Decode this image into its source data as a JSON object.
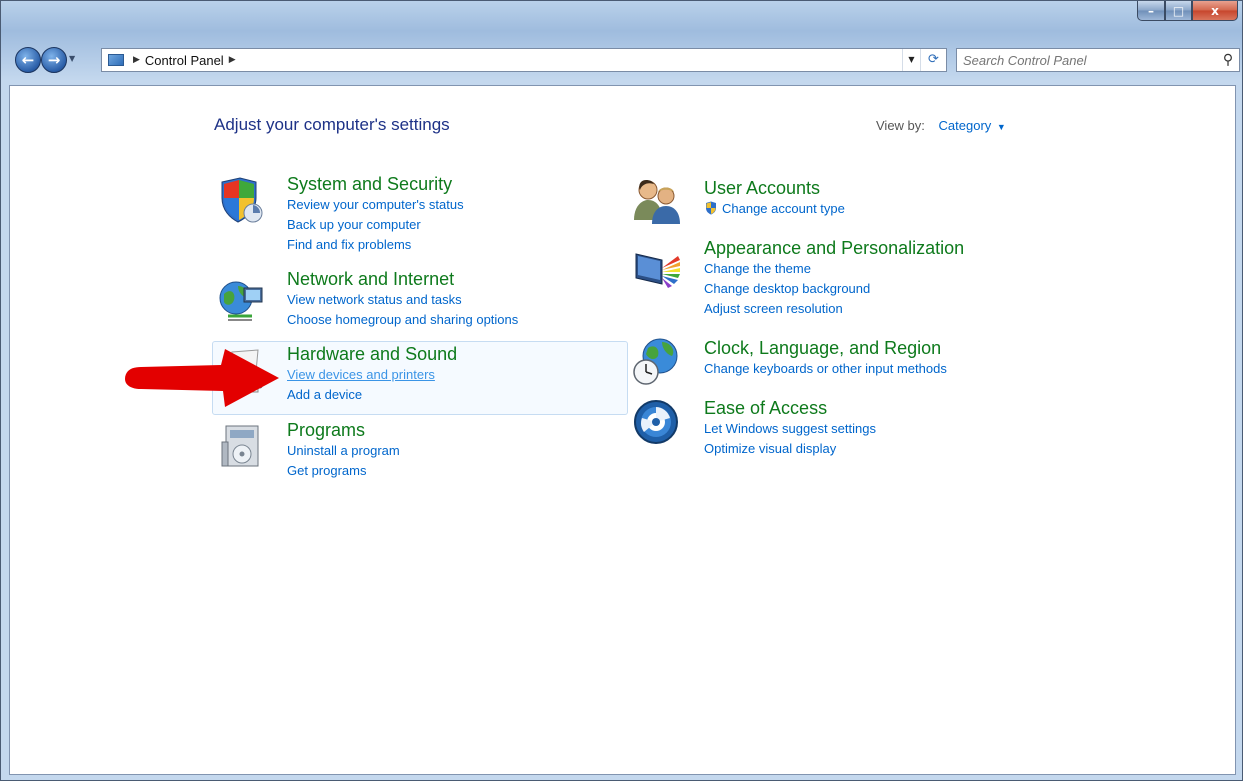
{
  "window": {
    "minimize_label": "–",
    "maximize_label": "□",
    "close_label": "x"
  },
  "nav": {
    "back_icon": "back-arrow-icon",
    "forward_icon": "forward-arrow-icon"
  },
  "address": {
    "crumb": "Control Panel"
  },
  "search": {
    "placeholder": "Search Control Panel"
  },
  "page": {
    "title": "Adjust your computer's settings",
    "view_by_label": "View by:",
    "view_by_value": "Category"
  },
  "categories": {
    "system_security": {
      "title": "System and Security",
      "links": [
        "Review your computer's status",
        "Back up your computer",
        "Find and fix problems"
      ]
    },
    "network_internet": {
      "title": "Network and Internet",
      "links": [
        "View network status and tasks",
        "Choose homegroup and sharing options"
      ]
    },
    "hardware_sound": {
      "title": "Hardware and Sound",
      "links": [
        "View devices and printers",
        "Add a device"
      ]
    },
    "programs": {
      "title": "Programs",
      "links": [
        "Uninstall a program",
        "Get programs"
      ]
    },
    "user_accounts": {
      "title": "User Accounts",
      "links": [
        "Change account type"
      ]
    },
    "appearance": {
      "title": "Appearance and Personalization",
      "links": [
        "Change the theme",
        "Change desktop background",
        "Adjust screen resolution"
      ]
    },
    "clock_language": {
      "title": "Clock, Language, and Region",
      "links": [
        "Change keyboards or other input methods"
      ]
    },
    "ease_of_access": {
      "title": "Ease of Access",
      "links": [
        "Let Windows suggest settings",
        "Optimize visual display"
      ]
    }
  },
  "colors": {
    "category_title": "#0e7a1c",
    "link": "#0066cc",
    "heading": "#1e3287",
    "annotation_arrow": "#e00000"
  }
}
